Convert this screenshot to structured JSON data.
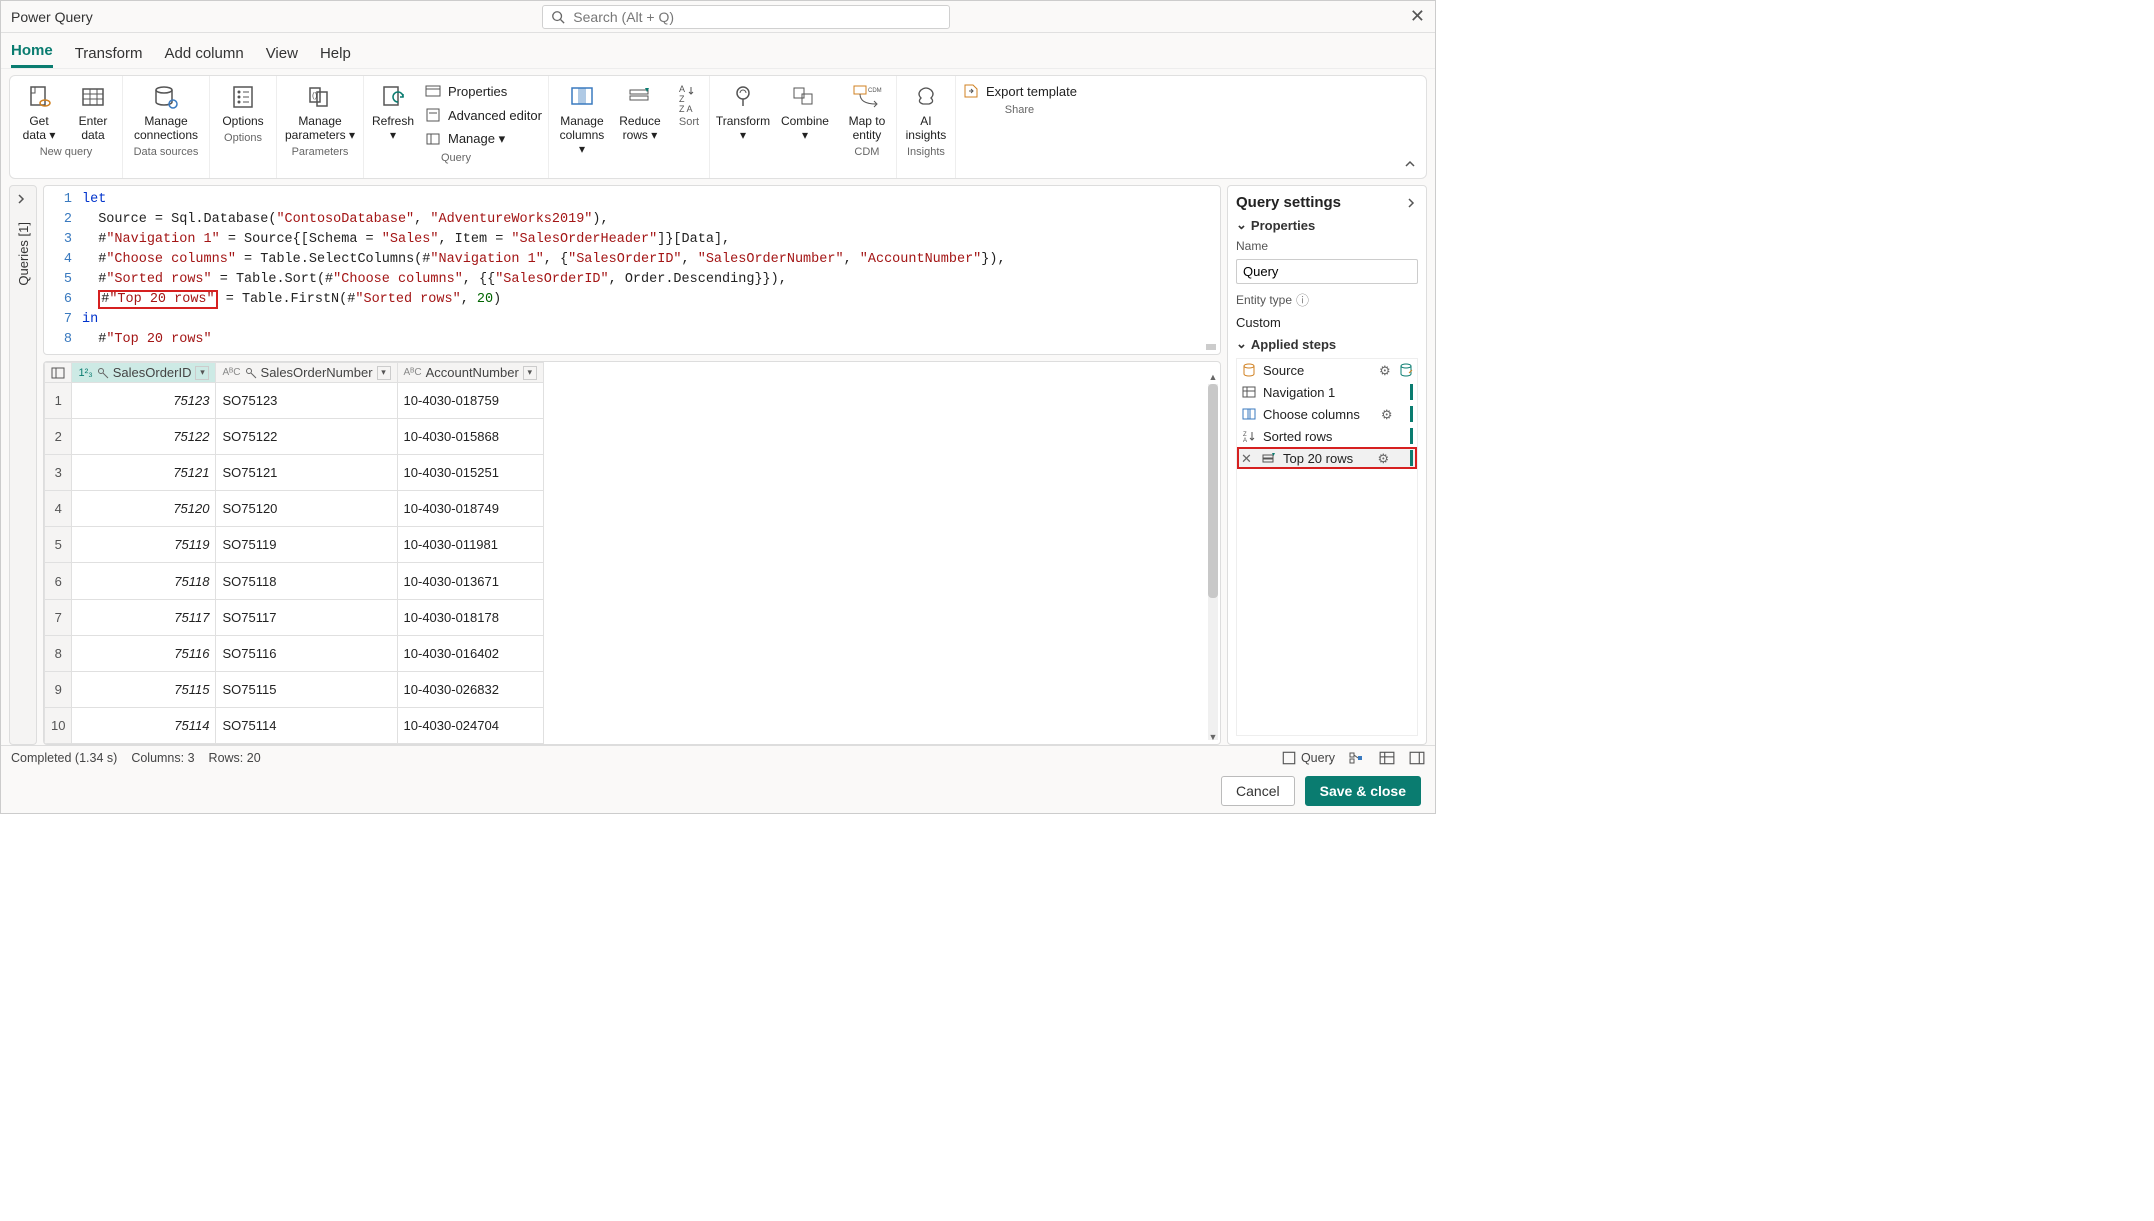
{
  "app_title": "Power Query",
  "search_placeholder": "Search (Alt + Q)",
  "tabs": {
    "home": "Home",
    "transform": "Transform",
    "addcol": "Add column",
    "view": "View",
    "help": "Help"
  },
  "ribbon": {
    "getdata": "Get data",
    "getdata_suffix": " ▾",
    "enterdata": "Enter data",
    "manageconn": "Manage connections",
    "options": "Options",
    "manageparams": "Manage parameters",
    "manageparams_suffix": " ▾",
    "refresh": "Refresh",
    "refresh_suffix": "▾",
    "properties": "Properties",
    "adveditor": "Advanced editor",
    "manage": "Manage ▾",
    "managecols": "Manage columns",
    "managecols_suffix": " ▾",
    "reducerows": "Reduce rows",
    "reducerows_suffix": " ▾",
    "transform": "Transform",
    "transform_suffix": "▾",
    "combine": "Combine",
    "combine_suffix": "▾",
    "maptoentity": "Map to entity",
    "aiinsights": "AI insights",
    "export": "Export template",
    "groups": {
      "newquery": "New query",
      "datasources": "Data sources",
      "options": "Options",
      "parameters": "Parameters",
      "query": "Query",
      "sort": "Sort",
      "cdm": "CDM",
      "insights": "Insights",
      "share": "Share"
    }
  },
  "queries_label": "Queries [1]",
  "code": {
    "lines": [
      "1",
      "2",
      "3",
      "4",
      "5",
      "6",
      "7",
      "8"
    ],
    "l1_kw": "let",
    "l2_a": "  Source = Sql.Database(",
    "l2_s1": "\"ContosoDatabase\"",
    "l2_b": ", ",
    "l2_s2": "\"AdventureWorks2019\"",
    "l2_c": "),",
    "l3_a": "  #",
    "l3_s1": "\"Navigation 1\"",
    "l3_b": " = Source{[Schema = ",
    "l3_s2": "\"Sales\"",
    "l3_c": ", Item = ",
    "l3_s3": "\"SalesOrderHeader\"",
    "l3_d": "]}[Data],",
    "l4_a": "  #",
    "l4_s1": "\"Choose columns\"",
    "l4_b": " = Table.SelectColumns(#",
    "l4_s2": "\"Navigation 1\"",
    "l4_c": ", {",
    "l4_s3": "\"SalesOrderID\"",
    "l4_d": ", ",
    "l4_s4": "\"SalesOrderNumber\"",
    "l4_e": ", ",
    "l4_s5": "\"AccountNumber\"",
    "l4_f": "}),",
    "l5_a": "  #",
    "l5_s1": "\"Sorted rows\"",
    "l5_b": " = Table.Sort(#",
    "l5_s2": "\"Choose columns\"",
    "l5_c": ", {{",
    "l5_s3": "\"SalesOrderID\"",
    "l5_d": ", Order.Descending}}),",
    "l6_a": "  ",
    "l6_hl_a": "#",
    "l6_hl_s": "\"Top 20 rows\"",
    "l6_b": " = Table.FirstN(#",
    "l6_s2": "\"Sorted rows\"",
    "l6_c": ", ",
    "l6_n": "20",
    "l6_d": ")",
    "l7_kw": "in",
    "l8_a": "  #",
    "l8_s": "\"Top 20 rows\""
  },
  "grid": {
    "col1": "SalesOrderID",
    "col2": "SalesOrderNumber",
    "col3": "AccountNumber",
    "type_num": "1²₃",
    "type_txt": "AᴮC",
    "rows": [
      {
        "n": "1",
        "id": "75123",
        "so": "SO75123",
        "ac": "10-4030-018759"
      },
      {
        "n": "2",
        "id": "75122",
        "so": "SO75122",
        "ac": "10-4030-015868"
      },
      {
        "n": "3",
        "id": "75121",
        "so": "SO75121",
        "ac": "10-4030-015251"
      },
      {
        "n": "4",
        "id": "75120",
        "so": "SO75120",
        "ac": "10-4030-018749"
      },
      {
        "n": "5",
        "id": "75119",
        "so": "SO75119",
        "ac": "10-4030-011981"
      },
      {
        "n": "6",
        "id": "75118",
        "so": "SO75118",
        "ac": "10-4030-013671"
      },
      {
        "n": "7",
        "id": "75117",
        "so": "SO75117",
        "ac": "10-4030-018178"
      },
      {
        "n": "8",
        "id": "75116",
        "so": "SO75116",
        "ac": "10-4030-016402"
      },
      {
        "n": "9",
        "id": "75115",
        "so": "SO75115",
        "ac": "10-4030-026832"
      },
      {
        "n": "10",
        "id": "75114",
        "so": "SO75114",
        "ac": "10-4030-024704"
      }
    ]
  },
  "settings": {
    "title": "Query settings",
    "properties": "Properties",
    "name_label": "Name",
    "name_value": "Query",
    "entity_label": "Entity type",
    "entity_value": "Custom",
    "applied": "Applied steps",
    "steps": {
      "source": "Source",
      "nav": "Navigation 1",
      "choose": "Choose columns",
      "sort": "Sorted rows",
      "top": "Top 20 rows"
    }
  },
  "status": {
    "completed": "Completed (1.34 s)",
    "cols": "Columns: 3",
    "rows": "Rows: 20",
    "query": "Query"
  },
  "footer": {
    "cancel": "Cancel",
    "save": "Save & close"
  }
}
